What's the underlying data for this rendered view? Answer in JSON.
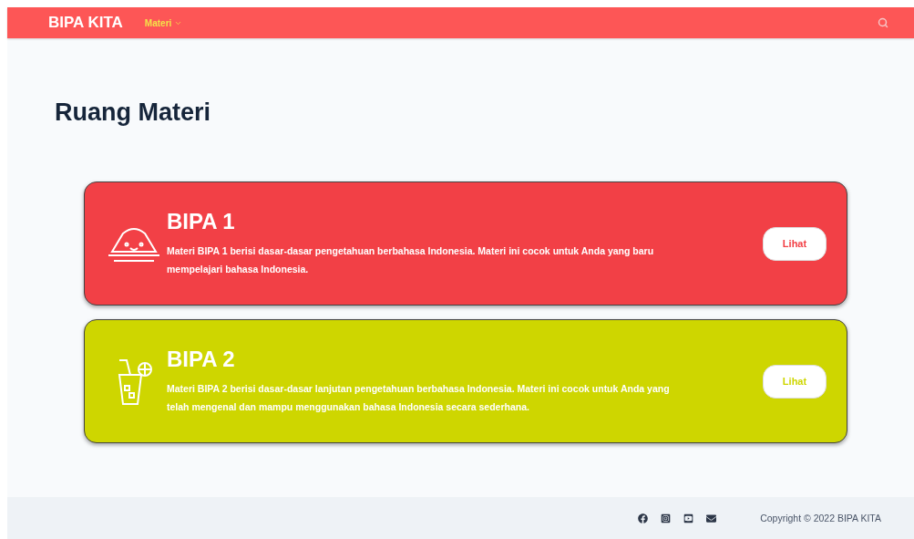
{
  "header": {
    "logo": "BIPA KITA",
    "nav": [
      {
        "label": "Materi",
        "expanded": false
      }
    ]
  },
  "page_title": "Ruang Materi",
  "cards": [
    {
      "title": "BIPA 1",
      "description": "Materi BIPA 1 berisi dasar-dasar pengetahuan berbahasa Indonesia. Materi ini cocok untuk Anda yang baru mempelajari bahasa Indonesia.",
      "button": "Lihat",
      "color": "#f24046"
    },
    {
      "title": "BIPA 2",
      "description": "Materi BIPA 2 berisi dasar-dasar lanjutan pengetahuan berbahasa Indonesia. Materi ini cocok untuk Anda yang telah mengenal dan mampu menggunakan bahasa Indonesia secara sederhana.",
      "button": "Lihat",
      "color": "#ced600"
    }
  ],
  "footer": {
    "copyright": "Copyright © 2022 BIPA KITA"
  }
}
